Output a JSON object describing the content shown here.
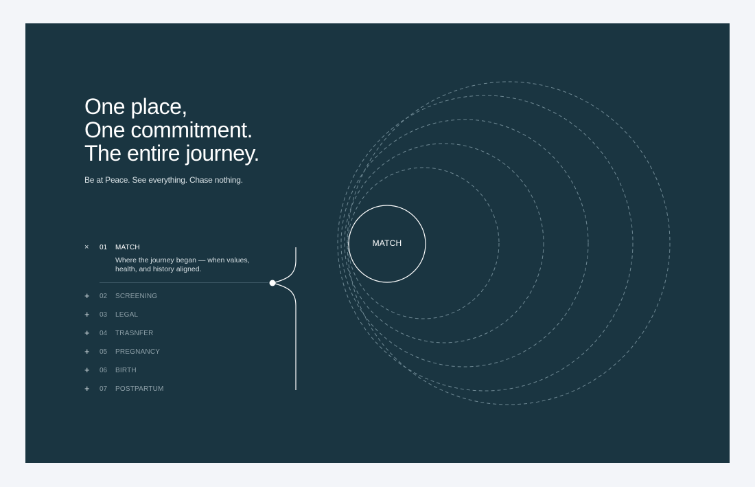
{
  "hero": {
    "headline_lines": [
      "One place,",
      "One commitment.",
      "The entire journey."
    ],
    "tagline": "Be at Peace. See everything. Chase nothing."
  },
  "steps": [
    {
      "toggle": "×",
      "num": "01",
      "label": "MATCH",
      "description": "Where the journey began — when values, health, and history aligned.",
      "expanded": true
    },
    {
      "toggle": "+",
      "num": "02",
      "label": "SCREENING",
      "expanded": false
    },
    {
      "toggle": "+",
      "num": "03",
      "label": "LEGAL",
      "expanded": false
    },
    {
      "toggle": "+",
      "num": "04",
      "label": "TRASNFER",
      "expanded": false
    },
    {
      "toggle": "+",
      "num": "05",
      "label": "PREGNANCY",
      "expanded": false
    },
    {
      "toggle": "+",
      "num": "06",
      "label": "BIRTH",
      "expanded": false
    },
    {
      "toggle": "+",
      "num": "07",
      "label": "POSTPARTUM",
      "expanded": false
    }
  ],
  "graphic": {
    "center_label": "MATCH",
    "colors": {
      "background": "#1a3541",
      "page": "#f3f5f9",
      "line": "#ffffff",
      "dashed_ring": "#6f8994"
    }
  }
}
